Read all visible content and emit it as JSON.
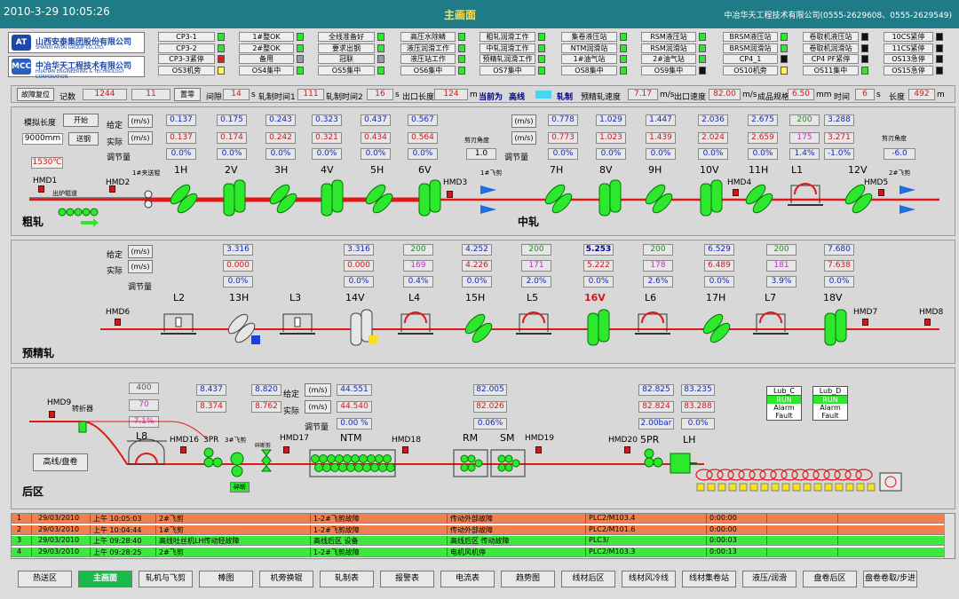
{
  "topbar": {
    "datetime": "2010-3-29 10:05:26",
    "title": "主画面",
    "company": "中冶华天工程技术有限公司(0555-2629608、0555-2629549)"
  },
  "logos": [
    {
      "text": "山西安泰集团股份有限公司",
      "sub": "SHANXI ANTAI GROUP CO.,LTD.",
      "icon": "AT"
    },
    {
      "text": "中冶华天工程技术有限公司",
      "sub": "HUATIAN ENGINEERING & TECHNOLOGY CORPORATION",
      "icon": "MCC"
    }
  ],
  "status": {
    "col1": [
      "CP3-1",
      "CP3-2",
      "CP3-3紧停",
      "OS3机旁"
    ],
    "col2": [
      "1#整OK",
      "2#整OK",
      "备用",
      "OS4集中"
    ],
    "col3": [
      "全线准备好",
      "要求出钢",
      "冠联",
      "OS5集中"
    ],
    "col4": [
      "高压水除鳞",
      "液压润滑工作",
      "液压站工作",
      "OS6集中"
    ],
    "col5": [
      "粗轧润滑工作",
      "中轧润滑工作",
      "预精轧润滑工作",
      "OS7集中"
    ],
    "col6": [
      "集卷液压站",
      "NTM润滑站",
      "1#油气站",
      "OS8集中"
    ],
    "col7": [
      "RSM液压站",
      "RSM润滑站",
      "2#油气站",
      "OS9集中"
    ],
    "col8": [
      "BRSM液压站",
      "BRSM润滑站",
      "CP4_1",
      "OS10机旁"
    ],
    "col9": [
      "卷取机液压站",
      "卷取机润滑站",
      "CP4 PF紧停",
      "OS11集中"
    ],
    "col10": [
      "10CS紧停",
      "11CS紧停",
      "OS13急停",
      "OS15急停"
    ]
  },
  "infobar": {
    "reset": "故障复位",
    "count_label": "记数",
    "count": "1244",
    "count2": "11",
    "clear": "置零",
    "gap_label": "间隙",
    "gap": "14",
    "unit_s": "s",
    "roll1_label": "轧制时间1",
    "roll1": "111",
    "roll2_label": "轧制时间2",
    "roll2": "16",
    "exit_label": "出口长度",
    "exit": "124",
    "unit_m": "m",
    "current": "当前为",
    "current_line": "高线",
    "rolling": "轧制",
    "pre_speed_label": "预精轧速度",
    "pre_speed": "7.17",
    "unit_ms": "m/s",
    "out_speed_label": "出口速度",
    "out_speed": "82.00",
    "spec_label": "成品规格",
    "spec": "6.50",
    "unit_mm": "mm",
    "time_label": "时间",
    "time": "6",
    "len_label": "长度",
    "len": "492"
  },
  "rough": {
    "sim_label": "模拟长度",
    "start": "开始",
    "sim_val": "9000mm",
    "steel": "送钢",
    "temp": "1530℃",
    "given": "给定",
    "actual": "实际",
    "adjust": "调节量",
    "unit": "(m/s)",
    "set": [
      "0.137",
      "0.175",
      "0.243",
      "0.323",
      "0.437",
      "0.567"
    ],
    "act": [
      "0.137",
      "0.174",
      "0.242",
      "0.321",
      "0.434",
      "0.564"
    ],
    "adj": [
      "0.0%",
      "0.0%",
      "0.0%",
      "0.0%",
      "0.0%",
      "0.0%"
    ],
    "stands": [
      "1H",
      "2V",
      "3H",
      "4V",
      "5H",
      "6V"
    ],
    "shear_angle": "剪刃角度",
    "shear_val": "1.0",
    "shear1": "1#飞剪",
    "caiji": "1#夹送辊",
    "hmd1": "HMD1",
    "hmd2": "HMD2",
    "hmd3": "HMD3",
    "furnace": "出炉辊道",
    "name": "粗轧"
  },
  "middle": {
    "set": [
      "0.778",
      "1.029",
      "1.447",
      "2.036",
      "2.675",
      "200",
      "3.288"
    ],
    "act": [
      "0.773",
      "1.023",
      "1.439",
      "2.024",
      "2.659",
      "175",
      "3.271"
    ],
    "adj": [
      "0.0%",
      "0.0%",
      "0.0%",
      "0.0%",
      "0.0%",
      "1.4%",
      "-1.0%"
    ],
    "stands": [
      "7H",
      "8V",
      "9H",
      "10V",
      "11H",
      "L1",
      "12V"
    ],
    "shear_angle": "剪刃角度",
    "shear_val": "-6.0",
    "shear2": "2#飞剪",
    "hmd4": "HMD4",
    "hmd5": "HMD5",
    "name": "中轧"
  },
  "pre": {
    "set": [
      "3.316",
      "3.316",
      "200",
      "4.252",
      "200",
      "5.253",
      "200",
      "6.529",
      "200",
      "7.680"
    ],
    "act": [
      "0.000",
      "0.000",
      "169",
      "4.226",
      "171",
      "5.222",
      "178",
      "6.489",
      "181",
      "7.638"
    ],
    "adj": [
      "0.0%",
      "0.0%",
      "0.4%",
      "0.0%",
      "2.0%",
      "0.0%",
      "2.6%",
      "0.0%",
      "3.9%",
      "0.0%"
    ],
    "stands": [
      "L2",
      "13H",
      "L3",
      "14V",
      "L4",
      "15H",
      "L5",
      "16V",
      "L6",
      "17H",
      "L7",
      "18V"
    ],
    "hmd6": "HMD6",
    "hmd7": "HMD7",
    "hmd8": "HMD8",
    "name": "预精轧"
  },
  "back": {
    "l8": [
      "400",
      "70",
      "7.1%"
    ],
    "pr3": [
      "8.437",
      "8.374"
    ],
    "pr3b": [
      "8.820",
      "8.762"
    ],
    "ntm": [
      "44.551",
      "44.540",
      "0.00 %"
    ],
    "rm": [
      "82.005",
      "82.026",
      "0.06%"
    ],
    "pr5": [
      "82.825",
      "82.824",
      "2.00bar"
    ],
    "lh": [
      "83.235",
      "83.288",
      "0.0%"
    ],
    "lubc": [
      "Lub_C",
      "RUN",
      "Alarm",
      "Fault"
    ],
    "lubd": [
      "Lub_D",
      "RUN",
      "Alarm",
      "Fault"
    ],
    "hmd9": "HMD9",
    "turn": "转折器",
    "hmd16": "HMD16",
    "hmd17": "HMD17",
    "hmd18": "HMD18",
    "hmd19": "HMD19",
    "hmd20": "HMD20",
    "l8n": "L8",
    "pr3n": "3PR",
    "shear3": "3#飞剪",
    "cut": "碎断剪",
    "ntmn": "NTM",
    "rmn": "RM",
    "smn": "SM",
    "pr5n": "5PR",
    "lhn": "LH",
    "coil": "高线/盘卷",
    "name": "后区",
    "crush": "碎断"
  },
  "alarms": [
    {
      "n": "1",
      "d": "29/03/2010",
      "t": "上午 10:05:03",
      "s": "2#飞剪",
      "a": "1-2#飞剪故障",
      "b": "传动外部故障",
      "c": "PLC2/M103.4",
      "x": "0:00:00"
    },
    {
      "n": "2",
      "d": "29/03/2010",
      "t": "上午 10:04:44",
      "s": "1#飞剪",
      "a": "1-2#飞剪故障",
      "b": "传动外部故障",
      "c": "PLC2/M101.6",
      "x": "0:00:00"
    },
    {
      "n": "3",
      "d": "29/03/2010",
      "t": "上午 09:28:40",
      "s": "高线吐丝机LH传动轻故障",
      "a": "高线后区 设备",
      "b": "高线后区 传动故障",
      "c": "PLC3/",
      "x": "0:00:03"
    },
    {
      "n": "4",
      "d": "29/03/2010",
      "t": "上午 09:28:25",
      "s": "2#飞剪",
      "a": "1-2#飞剪故障",
      "b": "电机风机停",
      "c": "PLC2/M103.3",
      "x": "0:00:13"
    }
  ],
  "nav": [
    "热送区",
    "主画面",
    "轧机与飞剪",
    "棒图",
    "机旁换辊",
    "轧制表",
    "报警表",
    "电流表",
    "趋势图",
    "线材后区",
    "线材风冷线",
    "线材集卷站",
    "液压/润滑",
    "盘卷后区",
    "盘卷卷取/步进"
  ]
}
